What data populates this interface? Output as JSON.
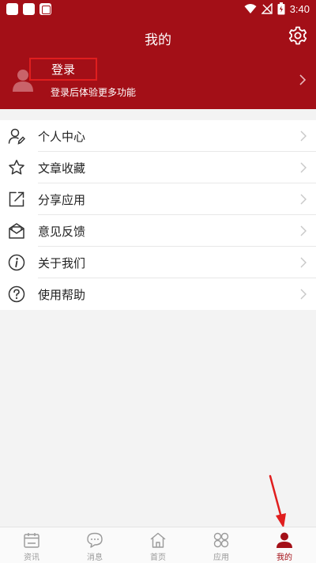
{
  "status_bar": {
    "time": "3:40"
  },
  "header": {
    "title": "我的"
  },
  "profile": {
    "login_label": "登录",
    "subtitle": "登录后体验更多功能"
  },
  "menu": {
    "items": [
      {
        "label": "个人中心",
        "icon": "user-edit-icon"
      },
      {
        "label": "文章收藏",
        "icon": "star-icon"
      },
      {
        "label": "分享应用",
        "icon": "share-icon"
      },
      {
        "label": "意见反馈",
        "icon": "feedback-icon"
      },
      {
        "label": "关于我们",
        "icon": "info-icon"
      },
      {
        "label": "使用帮助",
        "icon": "help-icon"
      }
    ]
  },
  "bottom_nav": {
    "tabs": [
      {
        "label": "资讯",
        "icon": "calendar-icon",
        "active": false
      },
      {
        "label": "消息",
        "icon": "chat-icon",
        "active": false
      },
      {
        "label": "首页",
        "icon": "home-icon",
        "active": false
      },
      {
        "label": "应用",
        "icon": "apps-icon",
        "active": false
      },
      {
        "label": "我的",
        "icon": "person-icon",
        "active": true
      }
    ]
  },
  "colors": {
    "brand": "#a30f17",
    "highlight": "#e01e1e",
    "active_tab": "#a30f17",
    "inactive_tab": "#9a9a9a"
  }
}
